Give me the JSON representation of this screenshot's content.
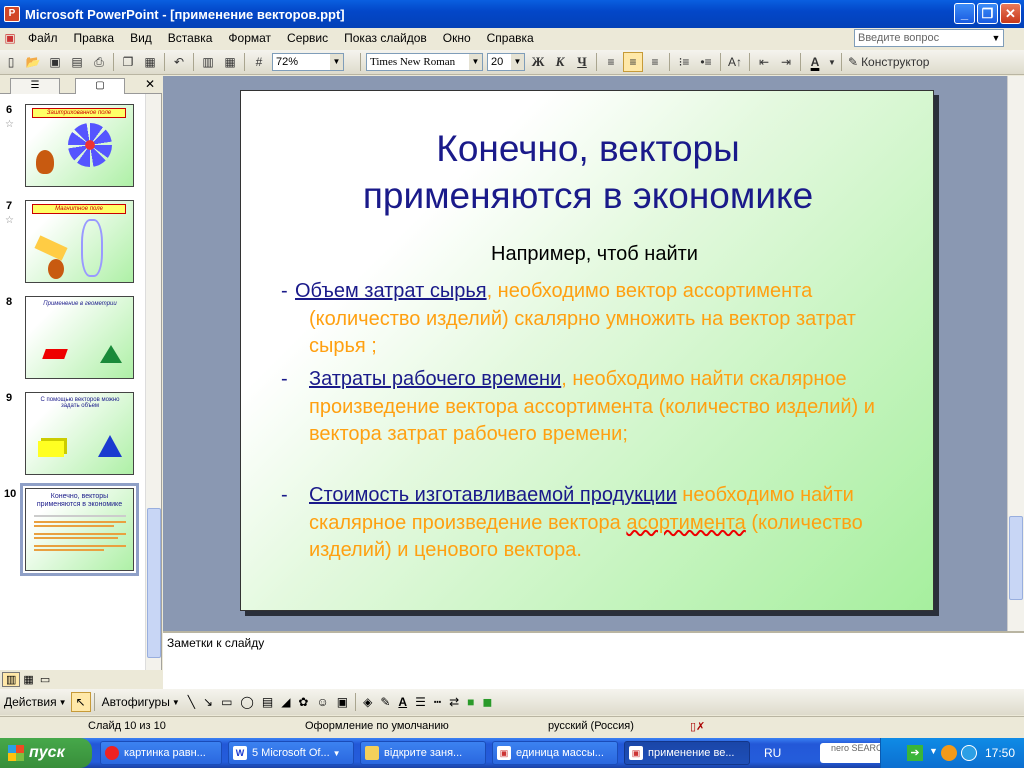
{
  "window": {
    "title": "Microsoft PowerPoint - [применение векторов.ppt]"
  },
  "menu": [
    "Файл",
    "Правка",
    "Вид",
    "Вставка",
    "Формат",
    "Сервис",
    "Показ слайдов",
    "Окно",
    "Справка"
  ],
  "help_placeholder": "Введите вопрос",
  "toolbar": {
    "zoom": "72%",
    "font": "Times New Roman",
    "size": "20",
    "bold": "Ж",
    "italic": "К",
    "underline": "Ч",
    "designer": "Конструктор"
  },
  "thumbnails": [
    {
      "num": "6",
      "banner": "Заштрихованное поле"
    },
    {
      "num": "7",
      "banner": "Магнитное поле"
    },
    {
      "num": "8",
      "banner": "Применение в геометрии"
    },
    {
      "num": "9",
      "banner": "С помощью векторов можно задать объем"
    },
    {
      "num": "10",
      "title_line1": "Конечно, векторы",
      "title_line2": "применяются в экономике"
    }
  ],
  "slide": {
    "title_line1": "Конечно, векторы",
    "title_line2": "применяются в экономике",
    "intro": "Например, чтоб найти",
    "p1_link": "Объем затрат сырья",
    "p1_rest": ", необходимо вектор ассортимента (количество изделий)  скалярно умножить на вектор затрат сырья ;",
    "p2_link": "Затраты рабочего времени",
    "p2_rest": ", необходимо найти скалярное произведение вектора ассортимента (количество изделий) и вектора  затрат рабочего времени;",
    "p3_link": "Стоимость изготавливаемой продукции",
    "p3_mid": " необходимо найти скалярное произведение вектора ",
    "p3_spell": "асортимента",
    "p3_end": " (количество изделий) и ценового вектора."
  },
  "notes_placeholder": "Заметки к слайду",
  "drawbar": {
    "actions": "Действия",
    "autoshapes": "Автофигуры"
  },
  "status": {
    "slide": "Слайд 10 из 10",
    "design": "Оформление по умолчанию",
    "language": "русский (Россия)"
  },
  "taskbar": {
    "start": "пуск",
    "tasks": [
      "картинка равн...",
      "5 Microsoft Of...",
      "відкрите заня...",
      "единица массы...",
      "применение ве..."
    ],
    "lang": "RU",
    "nero": "nero SEARCH",
    "clock": "17:50"
  }
}
